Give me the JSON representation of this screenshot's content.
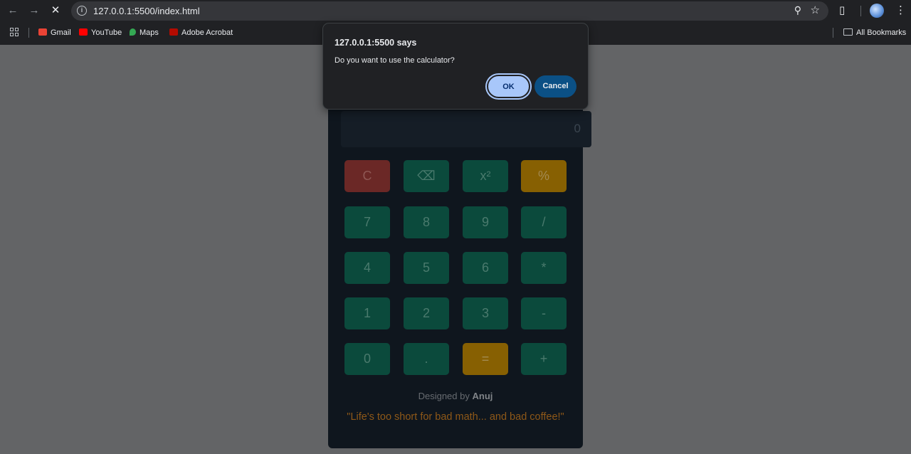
{
  "browser": {
    "url": "127.0.0.1:5500/index.html",
    "back_icon": "arrow-left-icon",
    "forward_icon": "arrow-right-icon",
    "stop_icon": "close-icon"
  },
  "bookmarks": [
    {
      "label": "Gmail",
      "color": "#ea4335"
    },
    {
      "label": "YouTube",
      "color": "#ff0000"
    },
    {
      "label": "Maps",
      "color": "#34a853"
    },
    {
      "label": "Adobe Acrobat",
      "color": "#b30b00"
    }
  ],
  "all_bookmarks": "All Bookmarks",
  "dialog": {
    "title": "127.0.0.1:5500 says",
    "message": "Do you want to use the calculator?",
    "ok": "OK",
    "cancel": "Cancel"
  },
  "calculator": {
    "display": "0",
    "keys": [
      {
        "label": "C",
        "style": "red"
      },
      {
        "label": "⌫",
        "style": "normal"
      },
      {
        "label": "x²",
        "style": "normal"
      },
      {
        "label": "%",
        "style": "amber"
      },
      {
        "label": "7",
        "style": "normal"
      },
      {
        "label": "8",
        "style": "normal"
      },
      {
        "label": "9",
        "style": "normal"
      },
      {
        "label": "/",
        "style": "normal"
      },
      {
        "label": "4",
        "style": "normal"
      },
      {
        "label": "5",
        "style": "normal"
      },
      {
        "label": "6",
        "style": "normal"
      },
      {
        "label": "*",
        "style": "normal"
      },
      {
        "label": "1",
        "style": "normal"
      },
      {
        "label": "2",
        "style": "normal"
      },
      {
        "label": "3",
        "style": "normal"
      },
      {
        "label": "-",
        "style": "normal"
      },
      {
        "label": "0",
        "style": "normal"
      },
      {
        "label": ".",
        "style": "normal"
      },
      {
        "label": "=",
        "style": "amber"
      },
      {
        "label": "+",
        "style": "normal"
      }
    ],
    "designed_prefix": "Designed by",
    "designed_name": "Anuj",
    "quote": "\"Life's too short for bad math... and bad coffee!\""
  },
  "colors": {
    "key_green": "#0b4a3c",
    "key_red": "#6b2826",
    "key_amber": "#876002",
    "ok_blue": "#a8c7fa",
    "cancel_blue": "#0b5085"
  }
}
